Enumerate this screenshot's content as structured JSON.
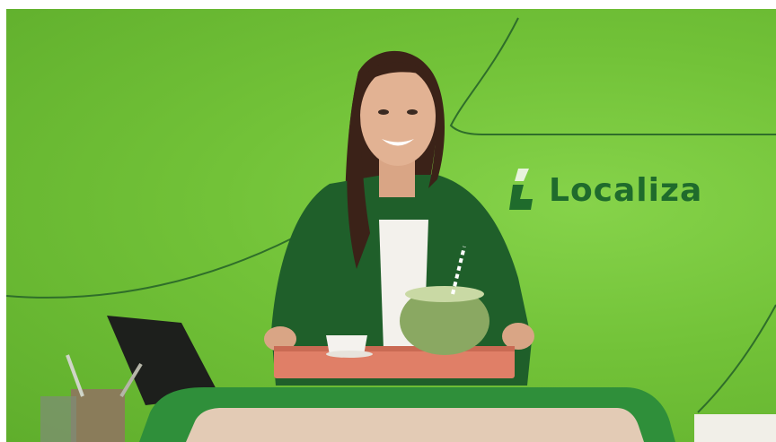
{
  "brand": {
    "name": "Localiza",
    "text_color": "#1f6b2c",
    "mark_colors": [
      "#1f6b2c",
      "#e8f3dd"
    ]
  },
  "scene": {
    "background_color": "#72c238",
    "accent_line_color": "#2f6e2a",
    "desk_color": "#2f8f3a",
    "tray_color": "#e07f67"
  }
}
